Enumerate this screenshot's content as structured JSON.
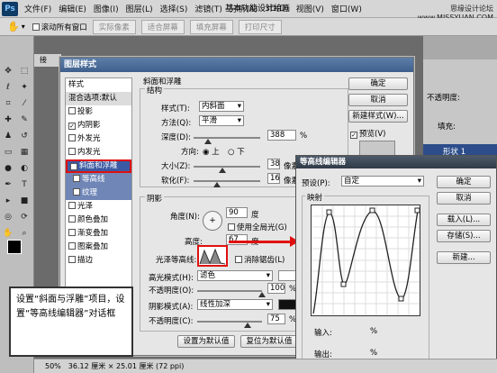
{
  "menubar": {
    "app_icon": "Ps",
    "items": [
      "文件(F)",
      "编辑(E)",
      "图像(I)",
      "图层(L)",
      "选择(S)",
      "滤镜(T)",
      "分析(A)",
      "3D(D)",
      "视图(V)",
      "窗口(W)"
    ],
    "workspace": "基本功能",
    "workspace2": "设计",
    "workspace3": "绘画"
  },
  "watermark": {
    "line1": "思缘设计论坛",
    "line2": "www.MISSYUAN.COM"
  },
  "optbar": {
    "scroll_all": "滚动所有窗口",
    "btn_actual": "实际像素",
    "btn_fit": "适合屏幕",
    "btn_fill": "填充屏幕",
    "btn_print": "打印尺寸"
  },
  "doc_tab": "接",
  "status": {
    "zoom": "50%",
    "size": "36.12 厘米 × 25.01 厘米 (72 ppi)"
  },
  "right_panel": {
    "opacity1": "不透明度:",
    "opacity2": "不透明度:",
    "fill": "填充:",
    "layer": "形状 1"
  },
  "layer_style": {
    "title": "图层样式",
    "list": [
      {
        "label": "样式",
        "check": false,
        "header": true
      },
      {
        "label": "混合选项:默认",
        "check": false,
        "header": true
      },
      {
        "label": "投影",
        "check": false
      },
      {
        "label": "内阴影",
        "check": true
      },
      {
        "label": "外发光",
        "check": false
      },
      {
        "label": "内发光",
        "check": false
      },
      {
        "label": "斜面和浮雕",
        "check": true,
        "selected": true
      },
      {
        "label": "等高线",
        "check": false,
        "sub": true
      },
      {
        "label": "纹理",
        "check": false,
        "sub": true
      },
      {
        "label": "光泽",
        "check": false
      },
      {
        "label": "颜色叠加",
        "check": false
      },
      {
        "label": "渐变叠加",
        "check": false
      },
      {
        "label": "图案叠加",
        "check": false
      },
      {
        "label": "描边",
        "check": false
      }
    ],
    "bevel_title": "斜面和浮雕",
    "structure_title": "结构",
    "style_label": "样式(T):",
    "style_value": "内斜面",
    "method_label": "方法(Q):",
    "method_value": "平滑",
    "depth_label": "深度(D):",
    "depth_value": "388",
    "direction_label": "方向:",
    "dir_up": "上",
    "dir_down": "下",
    "size_label": "大小(Z):",
    "size_value": "38",
    "soften_label": "软化(F):",
    "soften_value": "16",
    "shading_title": "阴影",
    "angle_label": "角度(N):",
    "angle_value": "90",
    "global_light": "使用全局光(G)",
    "altitude_label": "高度:",
    "altitude_value": "67",
    "gloss_label": "光泽等高线:",
    "antialias": "消除锯齿(L)",
    "highlight_label": "高光模式(H):",
    "highlight_value": "滤色",
    "opacity_label": "不透明度(O):",
    "opacity_value": "100",
    "shadow_label": "阴影模式(A):",
    "shadow_value": "线性加深",
    "opacity2_label": "不透明度(C):",
    "opacity2_value": "75",
    "pct": "%",
    "deg": "度",
    "px": "像素",
    "btn_default": "设置为默认值",
    "btn_reset": "复位为默认值",
    "btn_ok": "确定",
    "btn_cancel": "取消",
    "btn_new": "新建样式(W)...",
    "preview": "预览(V)"
  },
  "callout": {
    "text": "设置“斜面与浮雕”项目，设置“等高线编辑器”对话框"
  },
  "contour_editor": {
    "title": "等高线编辑器",
    "preset_label": "预设(P):",
    "preset_value": "自定",
    "mapping_title": "映射",
    "btn_ok": "确定",
    "btn_cancel": "取消",
    "btn_load": "载入(L)...",
    "btn_save": "存储(S)...",
    "btn_new": "新建...",
    "input_label": "输入:",
    "output_label": "输出:",
    "pct": "%"
  }
}
